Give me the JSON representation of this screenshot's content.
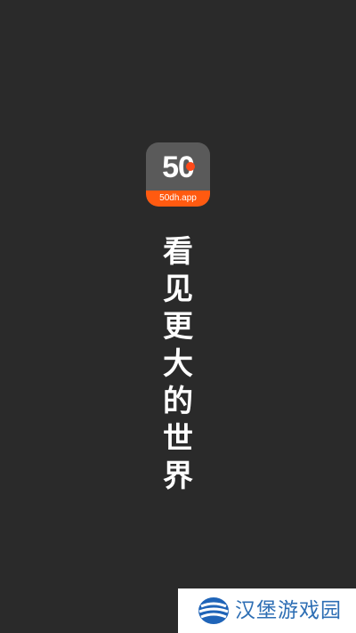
{
  "splash": {
    "background_color": "#2a2a2a",
    "app_icon": {
      "logo_number": "50",
      "domain": "50dh.app",
      "icon_background_color": "#5a5a5a",
      "band_color": "#ff5a10"
    },
    "slogan": {
      "chars": [
        "看",
        "见",
        "更",
        "大",
        "的",
        "世",
        "界"
      ]
    }
  },
  "watermark": {
    "text": "汉堡游戏园",
    "icon": "site-logo-icon",
    "text_color": "#2d6eb4"
  }
}
